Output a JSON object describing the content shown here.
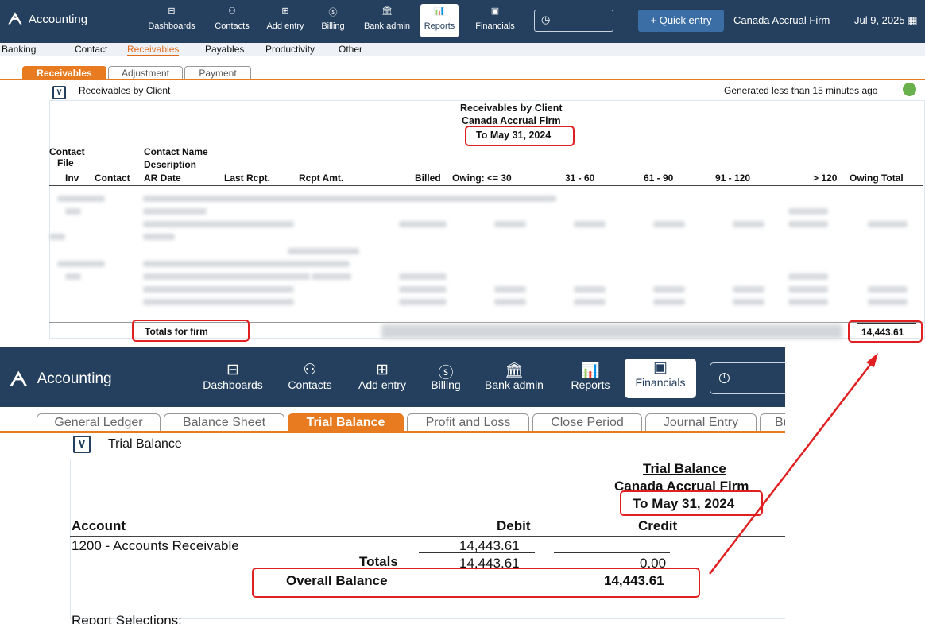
{
  "top": {
    "app_title": "Accounting",
    "nav": [
      {
        "label": "Dashboards",
        "icon": "dashboard-icon"
      },
      {
        "label": "Contacts",
        "icon": "contacts-icon"
      },
      {
        "label": "Add entry",
        "icon": "add-entry-icon"
      },
      {
        "label": "Billing",
        "icon": "billing-icon"
      },
      {
        "label": "Bank admin",
        "icon": "bank-icon"
      },
      {
        "label": "Reports",
        "icon": "reports-icon"
      },
      {
        "label": "Financials",
        "icon": "financials-icon"
      }
    ],
    "quick_entry": "+ Quick entry",
    "firm": "Canada Accrual Firm",
    "date": "Jul 9, 2025",
    "menu": [
      "Banking",
      "Contact",
      "Receivables",
      "Payables",
      "Productivity",
      "Other"
    ],
    "tabs": [
      "Receivables",
      "Adjustment",
      "Payment"
    ],
    "section_title": "Receivables by Client",
    "generated": "Generated less than 15 minutes ago",
    "report": {
      "title": "Receivables by Client",
      "firm": "Canada Accrual Firm",
      "date": "To May 31, 2024",
      "col_contact": "Contact",
      "col_file": "File",
      "col_inv": "Inv",
      "col_contact2": "Contact",
      "col_ardate": "AR Date",
      "col_name": "Contact Name",
      "col_desc": "Description",
      "col_lastrcpt": "Last Rcpt.",
      "col_rcptamt": "Rcpt Amt.",
      "col_billed": "Billed",
      "col_owing30": "Owing: <= 30",
      "col_31_60": "31 - 60",
      "col_61_90": "61 - 90",
      "col_91_120": "91 - 120",
      "col_120": "> 120",
      "col_total": "Owing Total",
      "totals_label": "Totals for firm",
      "total_value": "14,443.61"
    }
  },
  "bottom": {
    "app_title": "Accounting",
    "nav": [
      {
        "label": "Dashboards",
        "icon": "dashboard-icon"
      },
      {
        "label": "Contacts",
        "icon": "contacts-icon"
      },
      {
        "label": "Add entry",
        "icon": "add-entry-icon"
      },
      {
        "label": "Billing",
        "icon": "billing-icon"
      },
      {
        "label": "Bank admin",
        "icon": "bank-icon"
      },
      {
        "label": "Reports",
        "icon": "reports-icon"
      },
      {
        "label": "Financials",
        "icon": "financials-icon"
      }
    ],
    "tabs": [
      "General Ledger",
      "Balance Sheet",
      "Trial Balance",
      "Profit and Loss",
      "Close Period",
      "Journal Entry",
      "Bu"
    ],
    "section_title": "Trial Balance",
    "report": {
      "title": "Trial Balance",
      "firm": "Canada Accrual Firm",
      "date": "To May 31, 2024",
      "col_account": "Account",
      "col_debit": "Debit",
      "col_credit": "Credit",
      "row_account": "1200 - Accounts Receivable",
      "row_debit": "14,443.61",
      "totals_label": "Totals",
      "totals_debit": "14,443.61",
      "totals_credit": "0.00",
      "overall_label": "Overall Balance",
      "overall_value": "14,443.61",
      "selections": "Report Selections:"
    }
  },
  "colors": {
    "header": "#24405e",
    "accent": "#e87a1f",
    "highlight": "#e02020"
  }
}
